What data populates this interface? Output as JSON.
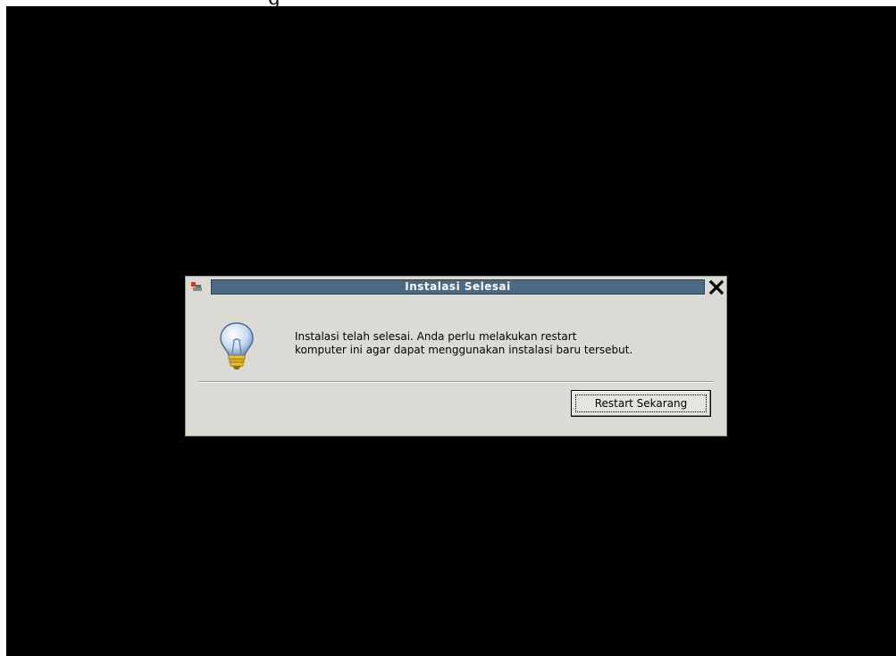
{
  "dialog": {
    "title": "Instalasi Selesai",
    "message_line1": "Instalasi telah selesai. Anda perlu melakukan restart",
    "message_line2": "komputer ini agar dapat menggunakan instalasi baru tersebut.",
    "restart_label": "Restart Sekarang"
  },
  "icons": {
    "app": "app-icon",
    "close": "close-icon",
    "info": "lightbulb-icon"
  },
  "colors": {
    "title_band": "#4b6983",
    "dialog_bg": "#dcdad5",
    "screen_bg": "#000000"
  }
}
